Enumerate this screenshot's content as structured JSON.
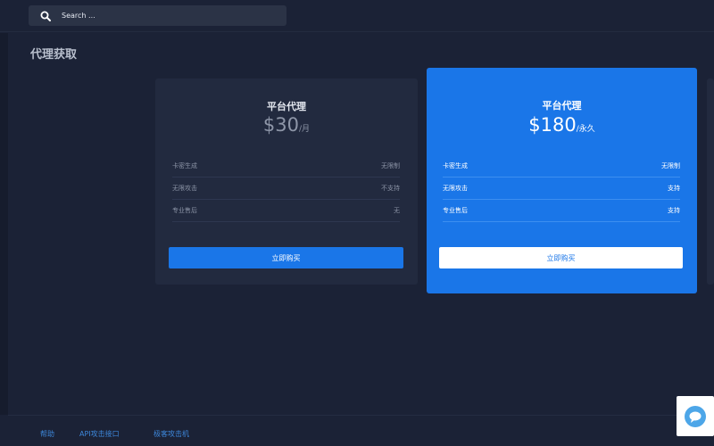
{
  "search": {
    "placeholder": "Search ..."
  },
  "page": {
    "title": "代理获取"
  },
  "plans": [
    {
      "name": "平台代理",
      "price": "$30",
      "unit": "/月",
      "features": [
        {
          "label": "卡密生成",
          "value": "无限制"
        },
        {
          "label": "无限攻击",
          "value": "不支持"
        },
        {
          "label": "专业售后",
          "value": "无"
        }
      ],
      "button": "立即购买"
    },
    {
      "name": "平台代理",
      "price": "$180",
      "unit": "/永久",
      "features": [
        {
          "label": "卡密生成",
          "value": "无限制"
        },
        {
          "label": "无限攻击",
          "value": "支持"
        },
        {
          "label": "专业售后",
          "value": "支持"
        }
      ],
      "button": "立即购买"
    }
  ],
  "footer": {
    "links": [
      "帮助",
      "API攻击接口",
      "极客攻击机"
    ]
  },
  "colors": {
    "background": "#1b2236",
    "card": "#222a3f",
    "accent": "#1a76e8",
    "link": "#3d86d8"
  },
  "icons": {
    "search": "search-icon",
    "chat": "chat-bubble-icon"
  }
}
